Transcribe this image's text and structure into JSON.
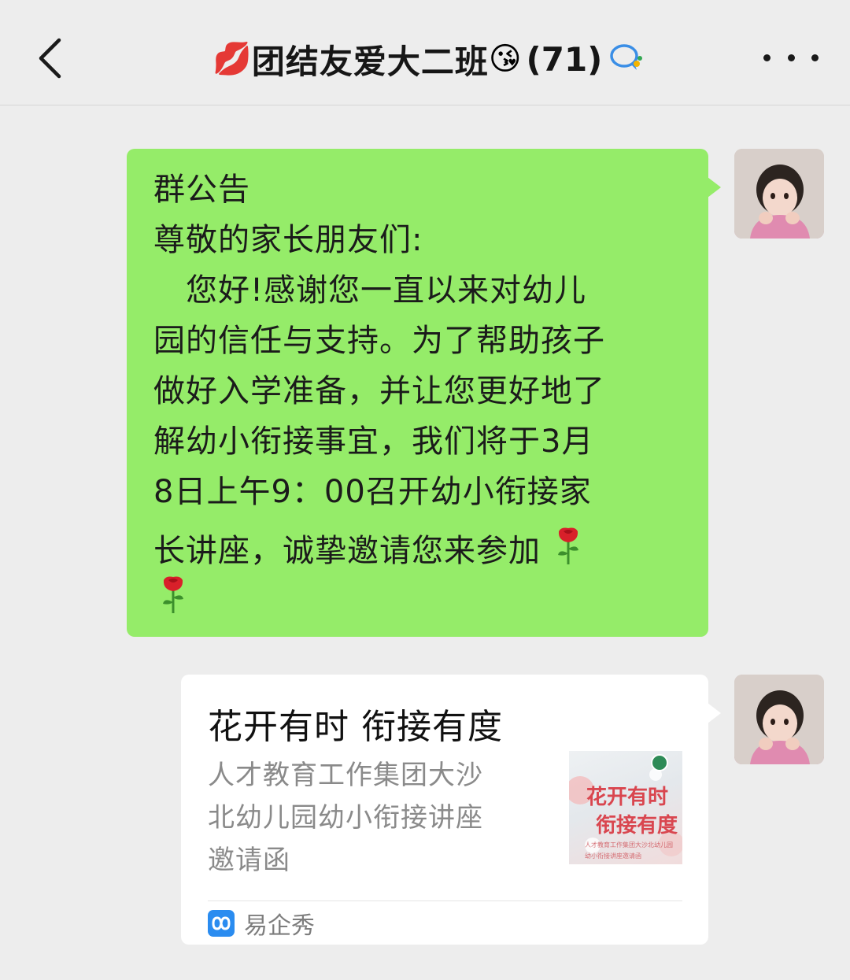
{
  "header": {
    "back_icon": "chevron-left-icon",
    "emoji_prefix": "💋",
    "group_name": "团结友爱大二班",
    "emoji_suffix": "😘",
    "member_count": "(71)",
    "chat_icon": "chat-bubble-icon",
    "more_icon": "more-dots-icon"
  },
  "messages": [
    {
      "type": "text",
      "bubble_color": "#95ec69",
      "lines": [
        "群公告",
        "尊敬的家长朋友们:",
        "　您好!感谢您一直以来对幼儿",
        "园的信任与支持。为了帮助孩子",
        "做好入学准备，并让您更好地了",
        "解幼小衔接事宜，我们将于3月",
        "8日上午9：00召开幼小衔接家",
        "长讲座，诚挚邀请您来参加"
      ],
      "rose_icon": "rose-icon"
    },
    {
      "type": "link-card",
      "title": "花开有时 衔接有度",
      "description_lines": [
        "人才教育工作集团大沙",
        "北幼儿园幼小衔接讲座",
        "邀请函"
      ],
      "thumbnail": {
        "title_line1": "花开有时",
        "title_line2": "衔接有度",
        "subtitle_line1": "人才教育工作集团大沙北幼儿园",
        "subtitle_line2": "幼小衔接讲座邀请函"
      },
      "source": {
        "icon": "yiqixiu-logo-icon",
        "name": "易企秀"
      }
    }
  ],
  "colors": {
    "background": "#ededed",
    "sent_bubble": "#95ec69",
    "card_bg": "#ffffff",
    "accent_red": "#d9464f"
  }
}
